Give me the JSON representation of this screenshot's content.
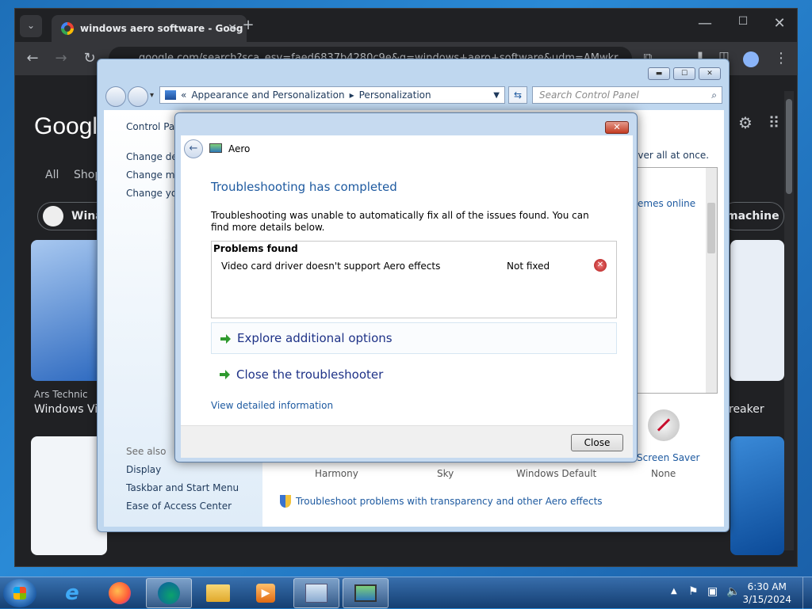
{
  "chrome": {
    "tab_title": "windows aero software - Goog",
    "url": "google.com/search?sca_esv=faed6837b4280c9e&q=windows+aero+software&udm=AMwkr",
    "google_logo": "Googl",
    "filters": [
      "All",
      "Shop"
    ],
    "chip_left": "Winac",
    "chip_right": "machine",
    "result_left_source": "Ars Technic",
    "result_left_title": "Windows Vis",
    "result_right_title": "reaker"
  },
  "control_panel": {
    "breadcrumb_prefix": "«",
    "breadcrumb": [
      "Appearance and Personalization",
      "Personalization"
    ],
    "search_placeholder": "Search Control Panel",
    "left_links": [
      "Control Pan",
      "Change des",
      "Change mo",
      "Change you"
    ],
    "see_also_label": "See also",
    "see_also_links": [
      "Display",
      "Taskbar and Start Menu",
      "Ease of Access Center"
    ],
    "right_text": "aver all at once.",
    "themes_online": "emes online",
    "screen_saver_label": "Screen Saver",
    "screen_saver_value": "None",
    "theme_names": [
      "Harmony",
      "Sky",
      "Windows Default"
    ],
    "troubleshoot_link": "Troubleshoot problems with transparency and other Aero effects"
  },
  "dialog": {
    "title": "Aero",
    "heading": "Troubleshooting has completed",
    "message": "Troubleshooting was unable to automatically fix all of the issues found. You can find more details below.",
    "problems_header": "Problems found",
    "problems": [
      {
        "name": "Video card driver doesn't support Aero effects",
        "status": "Not fixed"
      }
    ],
    "option1": "Explore additional options",
    "option2": "Close the troubleshooter",
    "details_link": "View detailed information",
    "close_button": "Close"
  },
  "taskbar": {
    "time": "6:30 AM",
    "date": "3/15/2024"
  },
  "colors": {
    "link_blue": "#1e3287",
    "heading_blue": "#1e5aa0",
    "error_red": "#c8102e"
  }
}
